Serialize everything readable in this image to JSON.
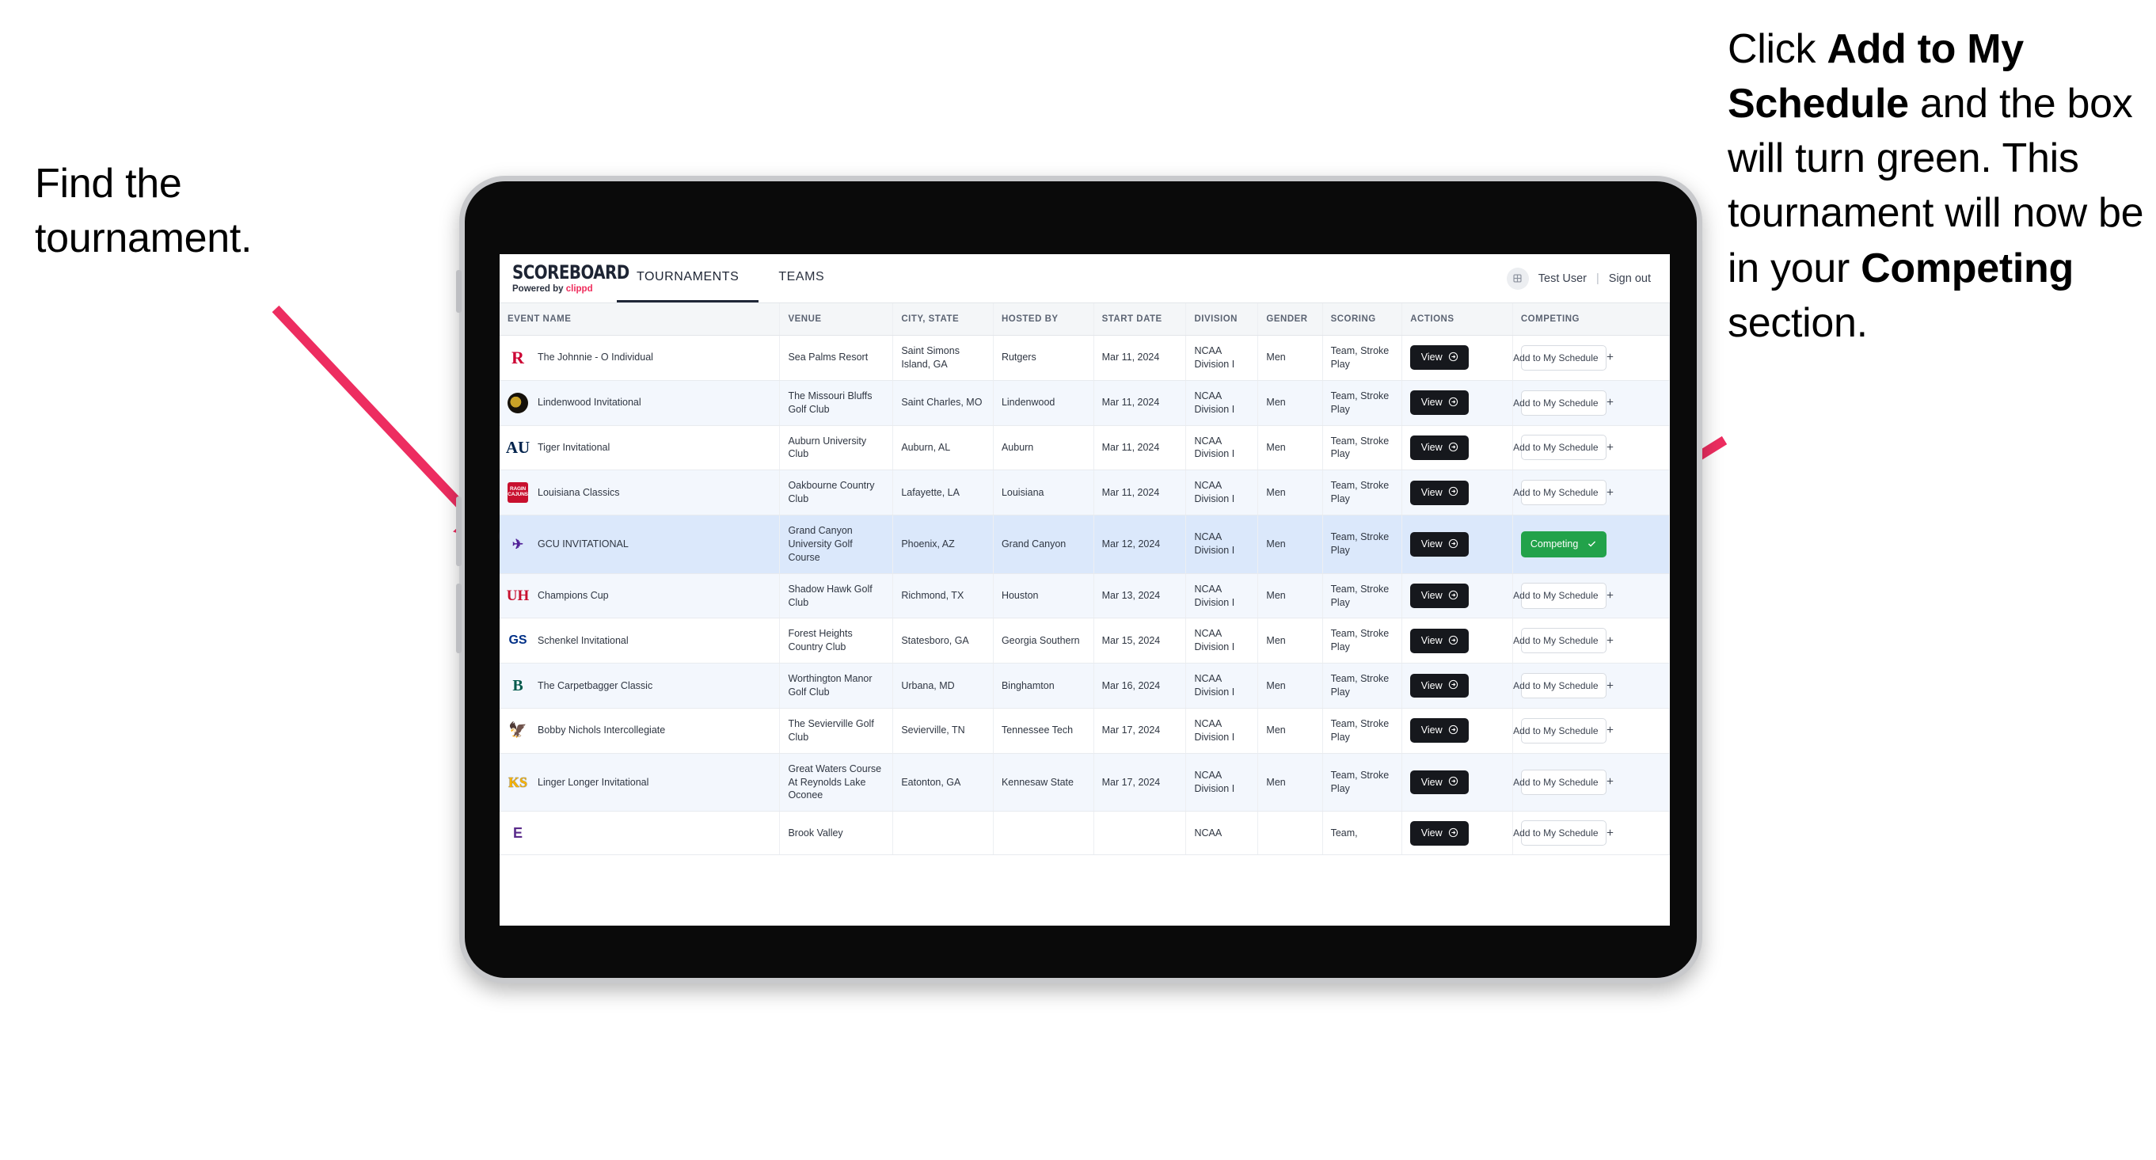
{
  "annotations": {
    "left": "Find the tournament.",
    "right_parts": [
      {
        "text": "Click ",
        "bold": false
      },
      {
        "text": "Add to My Schedule",
        "bold": true
      },
      {
        "text": " and the box will turn green. This tournament will now be in your ",
        "bold": false
      },
      {
        "text": "Competing",
        "bold": true
      },
      {
        "text": " section.",
        "bold": false
      }
    ],
    "arrow_color": "#ed2d60"
  },
  "app": {
    "brand": {
      "title": "SCOREBOARD",
      "powered_prefix": "Powered by ",
      "powered_brand": "clippd"
    },
    "nav": [
      {
        "label": "TOURNAMENTS",
        "active": true
      },
      {
        "label": "TEAMS",
        "active": false
      }
    ],
    "user": {
      "name": "Test User",
      "separator": "|",
      "signout": "Sign out",
      "avatar_icon": "user-avatar-icon"
    },
    "columns": [
      "EVENT NAME",
      "VENUE",
      "CITY, STATE",
      "HOSTED BY",
      "START DATE",
      "DIVISION",
      "GENDER",
      "SCORING",
      "ACTIONS",
      "COMPETING"
    ],
    "buttons": {
      "view": "View",
      "add": "Add to My Schedule",
      "competing": "Competing"
    },
    "rows": [
      {
        "logo": "R",
        "logo_class": "logo-rutgers",
        "event": "The Johnnie - O Individual",
        "venue": "Sea Palms Resort",
        "city": "Saint Simons Island, GA",
        "host": "Rutgers",
        "date": "Mar 11, 2024",
        "division": "NCAA Division I",
        "gender": "Men",
        "scoring": "Team, Stroke Play",
        "competing": false
      },
      {
        "logo": "",
        "logo_class": "logo-lindenwood",
        "event": "Lindenwood Invitational",
        "venue": "The Missouri Bluffs Golf Club",
        "city": "Saint Charles, MO",
        "host": "Lindenwood",
        "date": "Mar 11, 2024",
        "division": "NCAA Division I",
        "gender": "Men",
        "scoring": "Team, Stroke Play",
        "competing": false
      },
      {
        "logo": "AU",
        "logo_class": "logo-auburn",
        "event": "Tiger Invitational",
        "venue": "Auburn University Club",
        "city": "Auburn, AL",
        "host": "Auburn",
        "date": "Mar 11, 2024",
        "division": "NCAA Division I",
        "gender": "Men",
        "scoring": "Team, Stroke Play",
        "competing": false
      },
      {
        "logo": "RAGIN CAJUNS",
        "logo_class": "logo-louisiana",
        "event": "Louisiana Classics",
        "venue": "Oakbourne Country Club",
        "city": "Lafayette, LA",
        "host": "Louisiana",
        "date": "Mar 11, 2024",
        "division": "NCAA Division I",
        "gender": "Men",
        "scoring": "Team, Stroke Play",
        "competing": false
      },
      {
        "logo": "✈",
        "logo_class": "logo-gcu",
        "event": "GCU INVITATIONAL",
        "venue": "Grand Canyon University Golf Course",
        "city": "Phoenix, AZ",
        "host": "Grand Canyon",
        "date": "Mar 12, 2024",
        "division": "NCAA Division I",
        "gender": "Men",
        "scoring": "Team, Stroke Play",
        "competing": true
      },
      {
        "logo": "UH",
        "logo_class": "logo-houston",
        "event": "Champions Cup",
        "venue": "Shadow Hawk Golf Club",
        "city": "Richmond, TX",
        "host": "Houston",
        "date": "Mar 13, 2024",
        "division": "NCAA Division I",
        "gender": "Men",
        "scoring": "Team, Stroke Play",
        "competing": false
      },
      {
        "logo": "GS",
        "logo_class": "logo-gsouthern",
        "event": "Schenkel Invitational",
        "venue": "Forest Heights Country Club",
        "city": "Statesboro, GA",
        "host": "Georgia Southern",
        "date": "Mar 15, 2024",
        "division": "NCAA Division I",
        "gender": "Men",
        "scoring": "Team, Stroke Play",
        "competing": false
      },
      {
        "logo": "B",
        "logo_class": "logo-bingham",
        "event": "The Carpetbagger Classic",
        "venue": "Worthington Manor Golf Club",
        "city": "Urbana, MD",
        "host": "Binghamton",
        "date": "Mar 16, 2024",
        "division": "NCAA Division I",
        "gender": "Men",
        "scoring": "Team, Stroke Play",
        "competing": false
      },
      {
        "logo": "🦅",
        "logo_class": "logo-ttech",
        "event": "Bobby Nichols Intercollegiate",
        "venue": "The Sevierville Golf Club",
        "city": "Sevierville, TN",
        "host": "Tennessee Tech",
        "date": "Mar 17, 2024",
        "division": "NCAA Division I",
        "gender": "Men",
        "scoring": "Team, Stroke Play",
        "competing": false
      },
      {
        "logo": "KS",
        "logo_class": "logo-kennesaw",
        "event": "Linger Longer Invitational",
        "venue": "Great Waters Course At Reynolds Lake Oconee",
        "city": "Eatonton, GA",
        "host": "Kennesaw State",
        "date": "Mar 17, 2024",
        "division": "NCAA Division I",
        "gender": "Men",
        "scoring": "Team, Stroke Play",
        "competing": false
      },
      {
        "logo": "E",
        "logo_class": "logo-ecu",
        "event": "",
        "venue": "Brook Valley",
        "city": "",
        "host": "",
        "date": "",
        "division": "NCAA",
        "gender": "",
        "scoring": "Team,",
        "competing": false
      }
    ]
  }
}
